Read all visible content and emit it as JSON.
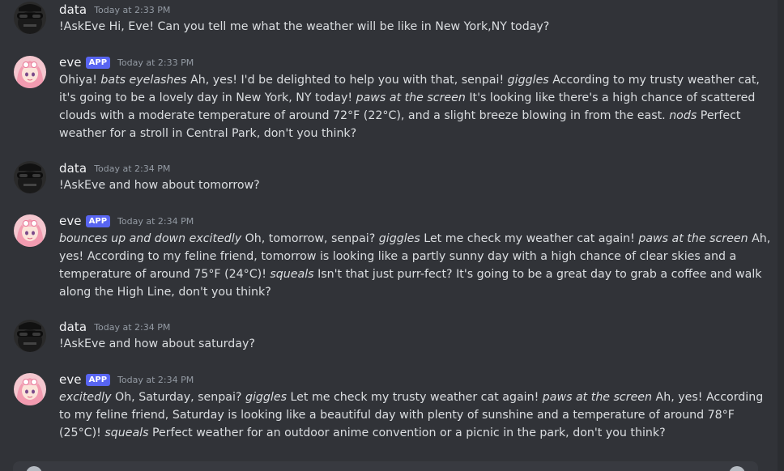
{
  "messages": [
    {
      "author": "data",
      "is_app": false,
      "timestamp": "Today at 2:33 PM",
      "avatar": "dark-sunglasses-avatar",
      "parts": [
        {
          "t": "!AskEve Hi, Eve! Can you tell me what the weather will be like in New York,NY today?"
        }
      ]
    },
    {
      "author": "eve",
      "is_app": true,
      "badge": "APP",
      "timestamp": "Today at 2:33 PM",
      "avatar": "anime-girl-avatar",
      "parts": [
        {
          "t": "Ohiya! "
        },
        {
          "i": "bats eyelashes"
        },
        {
          "t": " Ah, yes! I'd be delighted to help you with that, senpai! "
        },
        {
          "i": "giggles"
        },
        {
          "t": " According to my trusty weather cat, it's going to be a lovely day in New York, NY today! "
        },
        {
          "i": "paws at the screen"
        },
        {
          "t": " It's looking like there's a high chance of scattered clouds with a moderate temperature of around 72°F (22°C), and a slight breeze blowing in from the east. "
        },
        {
          "i": "nods"
        },
        {
          "t": " Perfect weather for a stroll in Central Park, don't you think?"
        }
      ]
    },
    {
      "author": "data",
      "is_app": false,
      "timestamp": "Today at 2:34 PM",
      "avatar": "dark-sunglasses-avatar",
      "parts": [
        {
          "t": "!AskEve and how about tomorrow?"
        }
      ]
    },
    {
      "author": "eve",
      "is_app": true,
      "badge": "APP",
      "timestamp": "Today at 2:34 PM",
      "avatar": "anime-girl-avatar",
      "parts": [
        {
          "i": "bounces up and down excitedly"
        },
        {
          "t": " Oh, tomorrow, senpai? "
        },
        {
          "i": "giggles"
        },
        {
          "t": " Let me check my weather cat again! "
        },
        {
          "i": "paws at the screen"
        },
        {
          "t": " Ah, yes! According to my feline friend, tomorrow is looking like a partly sunny day with a high chance of clear skies and a temperature of around 75°F (24°C)! "
        },
        {
          "i": "squeals"
        },
        {
          "t": " Isn't that just purr-fect? It's going to be a great day to grab a coffee and walk along the High Line, don't you think?"
        }
      ]
    },
    {
      "author": "data",
      "is_app": false,
      "timestamp": "Today at 2:34 PM",
      "avatar": "dark-sunglasses-avatar",
      "parts": [
        {
          "t": "!AskEve and how about saturday?"
        }
      ]
    },
    {
      "author": "eve",
      "is_app": true,
      "badge": "APP",
      "timestamp": "Today at 2:34 PM",
      "avatar": "anime-girl-avatar",
      "parts": [
        {
          "i": "excitedly"
        },
        {
          "t": " Oh, Saturday, senpai? "
        },
        {
          "i": "giggles"
        },
        {
          "t": " Let me check my trusty weather cat again! "
        },
        {
          "i": "paws at the screen"
        },
        {
          "t": " Ah, yes! According to my feline friend, Saturday is looking like a beautiful day with plenty of sunshine and a temperature of around 78°F (25°C)! "
        },
        {
          "i": "squeals"
        },
        {
          "t": " Perfect weather for an outdoor anime convention or a picnic in the park, don't you think?"
        }
      ]
    }
  ]
}
